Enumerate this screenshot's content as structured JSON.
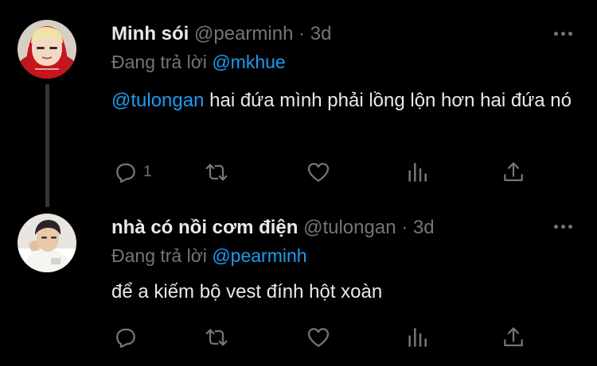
{
  "tweets": [
    {
      "display_name": "Minh sói",
      "handle": "@pearminh",
      "separator": "·",
      "time": "3d",
      "reply_prefix": "Đang trả lời",
      "reply_to": "@mkhue",
      "mention": "@tulongan",
      "text": "hai đứa mình phải lồng lộn hơn hai đứa nó",
      "reply_count": "1"
    },
    {
      "display_name": "nhà có nồi cơm điện",
      "handle": "@tulongan",
      "separator": "·",
      "time": "3d",
      "reply_prefix": "Đang trả lời",
      "reply_to": "@pearminh",
      "text": "để a kiếm bộ vest đính hột xoàn",
      "reply_count": ""
    }
  ],
  "colors": {
    "background": "#000000",
    "text": "#e7e9ea",
    "muted": "#71767b",
    "link": "#1d9bf0",
    "thread_line": "#333639"
  },
  "icons": [
    "reply-icon",
    "retweet-icon",
    "like-icon",
    "stats-icon",
    "share-icon",
    "more-icon"
  ]
}
